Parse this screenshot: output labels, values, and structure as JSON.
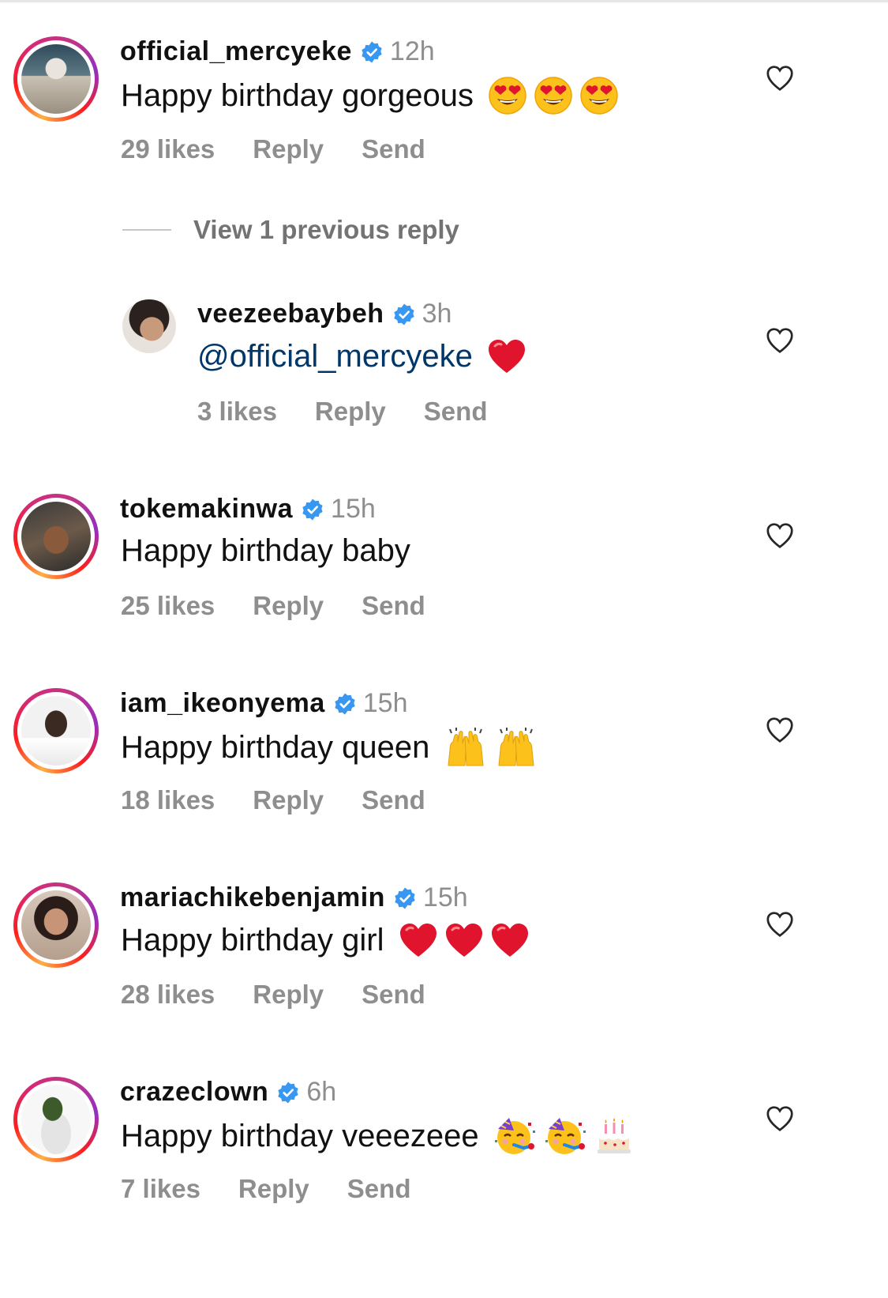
{
  "colors": {
    "text": "#111111",
    "secondary": "#8e8e8e",
    "mention": "#00376b",
    "verified": "#3897f0",
    "heart_emoji": "#e0152d"
  },
  "comments": [
    {
      "username": "official_mercyeke",
      "time": "12h",
      "text": "Happy birthday gorgeous",
      "emojis": [
        "heart-eyes-emoji",
        "heart-eyes-emoji",
        "heart-eyes-emoji"
      ],
      "likes": "29 likes",
      "reply": "Reply",
      "send": "Send"
    },
    {
      "username": "veezeebaybeh",
      "time": "3h",
      "mention": "@official_mercyeke",
      "emojis": [
        "red-heart-emoji"
      ],
      "likes": "3 likes",
      "reply": "Reply",
      "send": "Send"
    },
    {
      "username": "tokemakinwa",
      "time": "15h",
      "text": "Happy birthday baby",
      "likes": "25 likes",
      "reply": "Reply",
      "send": "Send"
    },
    {
      "username": "iam_ikeonyema",
      "time": "15h",
      "text": "Happy birthday queen",
      "emojis": [
        "raising-hands-emoji",
        "raising-hands-emoji"
      ],
      "likes": "18 likes",
      "reply": "Reply",
      "send": "Send"
    },
    {
      "username": "mariachikebenjamin",
      "time": "15h",
      "text": "Happy birthday girl",
      "emojis": [
        "red-heart-emoji",
        "red-heart-emoji",
        "red-heart-emoji"
      ],
      "likes": "28 likes",
      "reply": "Reply",
      "send": "Send"
    },
    {
      "username": "crazeclown",
      "time": "6h",
      "text": "Happy birthday veeezeee",
      "emojis": [
        "partying-face-emoji",
        "partying-face-emoji",
        "birthday-cake-emoji"
      ],
      "likes": "7 likes",
      "reply": "Reply",
      "send": "Send"
    }
  ],
  "view_replies": "View 1 previous reply"
}
